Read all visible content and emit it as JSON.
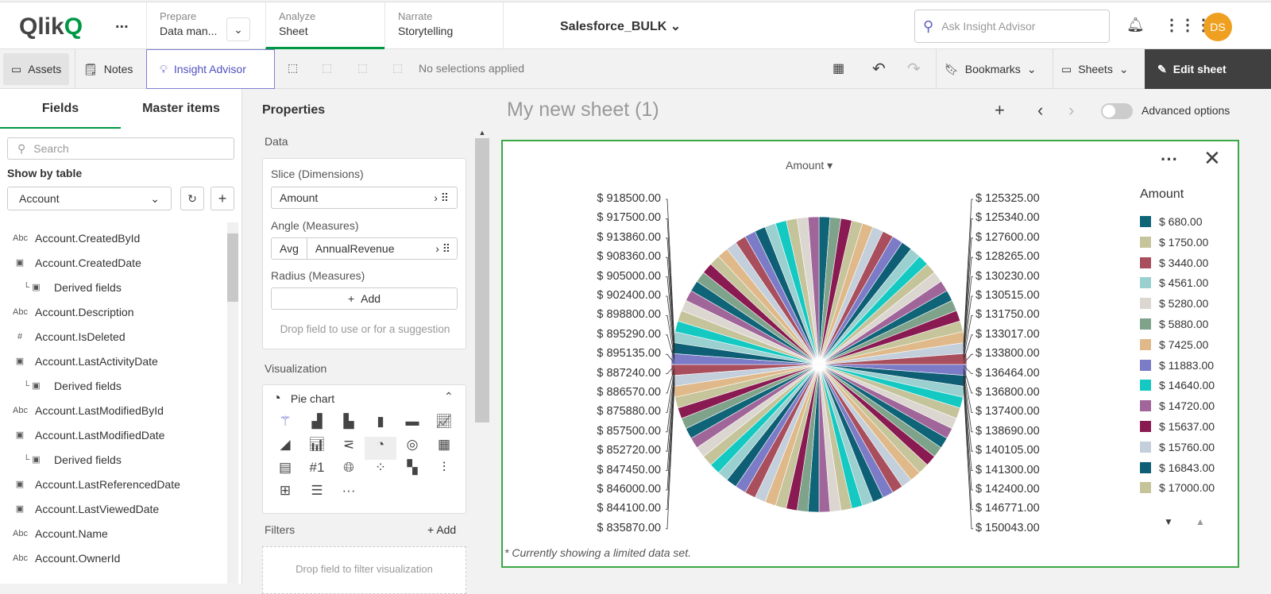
{
  "header": {
    "logo": "Qlik",
    "more": "...",
    "tabs": [
      {
        "small": "Prepare",
        "main": "Data man..."
      },
      {
        "small": "Analyze",
        "main": "Sheet"
      },
      {
        "small": "Narrate",
        "main": "Storytelling"
      }
    ],
    "app_title": "Salesforce_BULK",
    "search_placeholder": "Ask Insight Advisor",
    "avatar": "DS"
  },
  "toolbar": {
    "assets": "Assets",
    "notes": "Notes",
    "insight": "Insight Advisor",
    "selections": "No selections applied",
    "bookmarks": "Bookmarks",
    "sheets": "Sheets",
    "edit": "Edit sheet"
  },
  "left": {
    "tabs": [
      "Fields",
      "Master items"
    ],
    "search_placeholder": "Search",
    "show_by": "Show by table",
    "table": "Account",
    "fields": [
      {
        "icon": "Abc",
        "name": "Account.CreatedById"
      },
      {
        "icon": "cal",
        "name": "Account.CreatedDate"
      },
      {
        "icon": "sub",
        "name": "Derived fields"
      },
      {
        "icon": "Abc",
        "name": "Account.Description"
      },
      {
        "icon": "#",
        "name": "Account.IsDeleted"
      },
      {
        "icon": "cal",
        "name": "Account.LastActivityDate"
      },
      {
        "icon": "sub",
        "name": "Derived fields"
      },
      {
        "icon": "Abc",
        "name": "Account.LastModifiedById"
      },
      {
        "icon": "cal",
        "name": "Account.LastModifiedDate"
      },
      {
        "icon": "sub",
        "name": "Derived fields"
      },
      {
        "icon": "cal",
        "name": "Account.LastReferencedDate"
      },
      {
        "icon": "cal",
        "name": "Account.LastViewedDate"
      },
      {
        "icon": "Abc",
        "name": "Account.Name"
      },
      {
        "icon": "Abc",
        "name": "Account.OwnerId"
      }
    ]
  },
  "props": {
    "title": "Properties",
    "data": "Data",
    "slice": "Slice (Dimensions)",
    "dimension": "Amount",
    "angle": "Angle (Measures)",
    "agg": "Avg",
    "measure": "AnnualRevenue",
    "radius": "Radius (Measures)",
    "add": "Add",
    "drop_hint": "Drop field to use or for a suggestion",
    "visualization": "Visualization",
    "viz_type": "Pie chart",
    "filters": "Filters",
    "filters_add": "Add",
    "filter_hint": "Drop field to filter visualization"
  },
  "sheet": {
    "title": "My new sheet (1)",
    "advanced": "Advanced options"
  },
  "chart_data": {
    "type": "pie",
    "title": "Amount",
    "dimension": "Amount",
    "measure": "Avg AnnualRevenue",
    "footnote": "* Currently showing a limited data set.",
    "left_labels": [
      "$ 918500.00",
      "$ 917500.00",
      "$ 913860.00",
      "$ 908360.00",
      "$ 905000.00",
      "$ 902400.00",
      "$ 898800.00",
      "$ 895290.00",
      "$ 895135.00",
      "$ 887240.00",
      "$ 886570.00",
      "$ 875880.00",
      "$ 857500.00",
      "$ 852720.00",
      "$ 847450.00",
      "$ 846000.00",
      "$ 844100.00",
      "$ 835870.00"
    ],
    "right_labels": [
      "$ 125325.00",
      "$ 125340.00",
      "$ 127600.00",
      "$ 128265.00",
      "$ 130230.00",
      "$ 130515.00",
      "$ 131750.00",
      "$ 133017.00",
      "$ 133800.00",
      "$ 136464.00",
      "$ 136800.00",
      "$ 137400.00",
      "$ 138690.00",
      "$ 140105.00",
      "$ 141300.00",
      "$ 142400.00",
      "$ 146771.00",
      "$ 150043.00"
    ],
    "legend_title": "Amount",
    "legend": [
      "$ 680.00",
      "$ 1750.00",
      "$ 3440.00",
      "$ 4561.00",
      "$ 5280.00",
      "$ 5880.00",
      "$ 7425.00",
      "$ 11883.00",
      "$ 14640.00",
      "$ 14720.00",
      "$ 15637.00",
      "$ 15760.00",
      "$ 16843.00",
      "$ 17000.00"
    ],
    "colors": [
      "#0f6478",
      "#c6c49a",
      "#a84e5c",
      "#9ad0cf",
      "#dcd6d0",
      "#7ea38a",
      "#e0b98a",
      "#7b7bc7",
      "#15c9c3",
      "#a0669a",
      "#8a1a52",
      "#c4cfdc",
      "#0e5f75",
      "#c5c39a"
    ],
    "slice_count": 84
  }
}
